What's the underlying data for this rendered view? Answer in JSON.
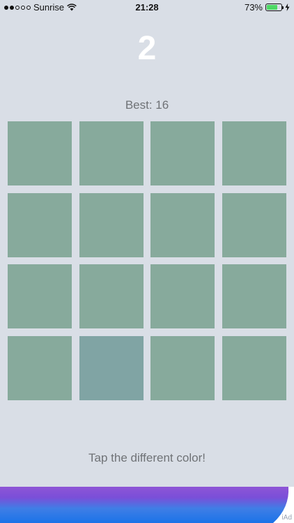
{
  "status_bar": {
    "carrier": "Sunrise",
    "time": "21:28",
    "battery_text": "73%",
    "battery_level": 0.73,
    "signal": {
      "filled": 2,
      "total": 5
    },
    "icons": [
      "wifi-icon",
      "battery-icon",
      "charging-bolt-icon"
    ]
  },
  "game": {
    "score": "2",
    "best": "Best: 16",
    "grid": {
      "rows": 4,
      "columns": 4,
      "tile_color": "#87aa9c",
      "odd_tile_color": "#80a4a4",
      "odd_tile_index": 13
    },
    "hint": "Tap the different color!"
  },
  "ad": {
    "label": "iAd"
  },
  "colors": {
    "background": "#d9dee6",
    "score_text": "#ffffff",
    "secondary_text": "#6f7276",
    "battery_green": "#4cd964"
  }
}
